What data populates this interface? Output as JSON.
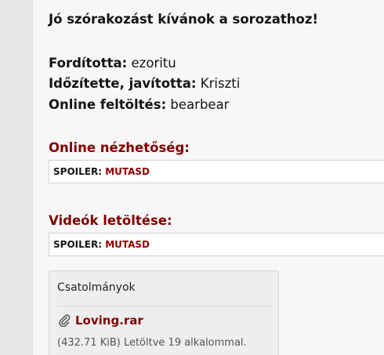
{
  "post": {
    "greeting": "Jó szórakozást kívánok a sorozathoz!",
    "credits": [
      {
        "label": "Fordította:",
        "value": "ezoritu"
      },
      {
        "label": "Időzítette, javította:",
        "value": "Kriszti"
      },
      {
        "label": "Online feltöltés:",
        "value": "bearbear"
      }
    ]
  },
  "sections": [
    {
      "title": "Online nézhetőség:",
      "spoiler_label": "SPOILER:",
      "spoiler_toggle": "MUTASD"
    },
    {
      "title": "Videók letöltése:",
      "spoiler_label": "SPOILER:",
      "spoiler_toggle": "MUTASD"
    }
  ],
  "attachments": {
    "title": "Csatolmányok",
    "icon": "paperclip-icon",
    "file_name": "Loving.rar",
    "file_meta": "(432.71 KiB) Letöltve 19 alkalommal."
  },
  "colors": {
    "accent": "#800000",
    "text": "#141414"
  }
}
